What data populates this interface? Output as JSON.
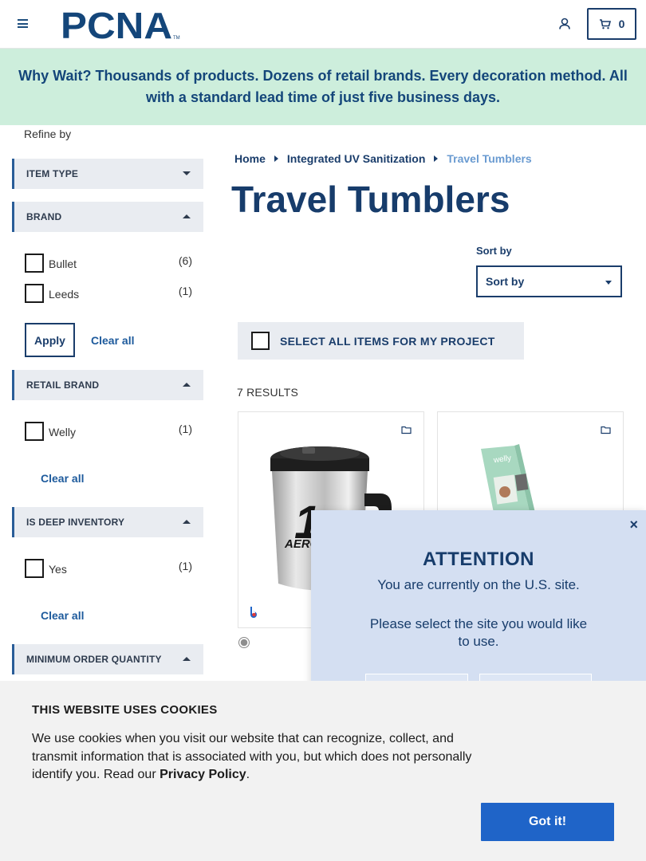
{
  "header": {
    "logo_text": "PCNA",
    "cart_count": "0",
    "icons": [
      "hamburger-menu-icon",
      "user-icon",
      "cart-icon"
    ]
  },
  "banner": {
    "text": "Why Wait? Thousands of products. Dozens of retail brands. Every decoration method. All with a standard lead time of just five business days."
  },
  "sidebar": {
    "refine_label": "Refine by",
    "filters": [
      {
        "label": "ITEM TYPE",
        "expanded": false
      },
      {
        "label": "BRAND",
        "expanded": true,
        "options": [
          {
            "label": "Bullet",
            "count": "(6)"
          },
          {
            "label": "Leeds",
            "count": "(1)"
          }
        ]
      },
      {
        "label": "RETAIL BRAND",
        "expanded": true,
        "options": [
          {
            "label": "Welly",
            "count": "(1)"
          }
        ]
      },
      {
        "label": "IS DEEP INVENTORY",
        "expanded": true,
        "options": [
          {
            "label": "Yes",
            "count": "(1)"
          }
        ]
      },
      {
        "label": "MINIMUM ORDER QUANTITY",
        "expanded": true
      }
    ],
    "apply_label": "Apply",
    "clear_all_label": "Clear all"
  },
  "main": {
    "breadcrumb": [
      "Home",
      "Integrated UV Sanitization",
      "Travel Tumblers"
    ],
    "title": "Travel Tumblers",
    "sort_label": "Sort by",
    "sort_value": "Sort by",
    "select_all_label": "SELECT ALL ITEMS FOR MY PROJECT",
    "results_count": "7 RESULTS",
    "products": [
      {
        "image_alt": "stainless travel mug with handle"
      },
      {
        "image_alt": "Welly tumbler packaging"
      }
    ]
  },
  "modal": {
    "close": "×",
    "title": "ATTENTION",
    "line1": "You are currently on the U.S. site.",
    "line2": "Please select the site you would like to use."
  },
  "cookie": {
    "title": "THIS WEBSITE USES COOKIES",
    "body": "We use cookies when you visit our website that can recognize, collect, and transmit information that is associated with you, but which does not personally identify you. Read our",
    "privacy_link": "Privacy Policy",
    "period": ".",
    "button": "Got it!"
  },
  "colors": {
    "brand_navy": "#173c6b",
    "banner_bg": "#cdeedc",
    "modal_bg": "#d4dff2",
    "cookie_button": "#1f64c8",
    "filter_bg": "#e9ecf1"
  }
}
